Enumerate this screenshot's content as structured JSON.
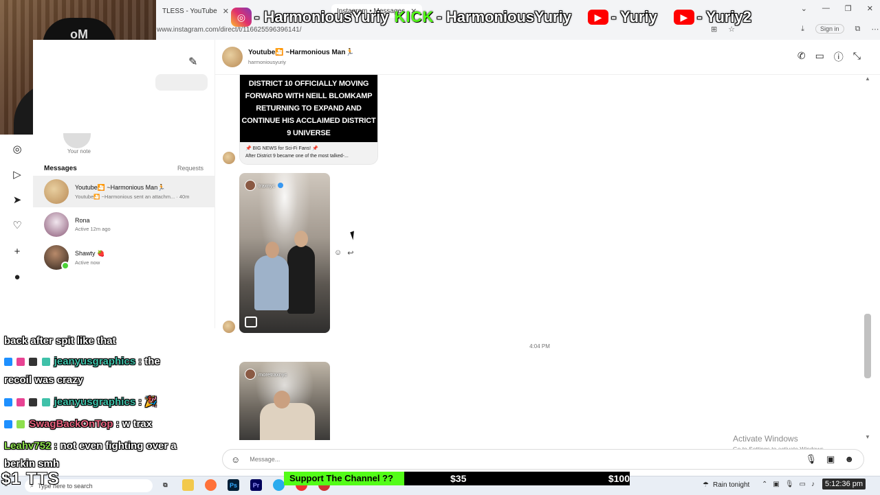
{
  "browser": {
    "tabs": [
      {
        "label": "TLESS - YouTube",
        "active": false
      },
      {
        "label": "Instagram • Messages",
        "active": true
      }
    ],
    "url": "www.instagram.com/direct/t/116625596396141/",
    "signin_label": "Sign in"
  },
  "social": {
    "instagram": "- HarmoniousYuriy",
    "kick_logo": "KICK",
    "kick": "- HarmoniousYuriy",
    "youtube1": "- Yuriy",
    "youtube2": "- Yuriy2"
  },
  "sidebar": {
    "note_label": "Your note",
    "messages_title": "Messages",
    "requests_label": "Requests",
    "conversations": [
      {
        "name": "Youtube🎦 ~Harmonious Man🏃",
        "sub": "Youtube🎦 ~Harmonious sent an attachm... · 40m",
        "avatar_color": "#c9a76c"
      },
      {
        "name": "Rona",
        "sub": "Active 12m ago",
        "avatar_color": "#8b5a78"
      },
      {
        "name": "Shawty 🍓",
        "sub": "Active now",
        "avatar_color": "#4a3a30"
      }
    ]
  },
  "chat": {
    "header_name": "Youtube🎦 ~Harmonious Man🏃",
    "header_handle": "harmoniousyuriy",
    "news_headline_lines": [
      "DISTRICT 10 OFFICIALLY MOVING",
      "FORWARD WITH NEILL BLOMKAMP",
      "RETURNING TO EXPAND AND",
      "CONTINUE HIS ACCLAIMED DISTRICT",
      "9 UNIVERSE"
    ],
    "news_caption_line1": "📌 BIG NEWS for Sci-Fi Fans! 📌",
    "news_caption_line2": "After District 9 became one of the most talked-...",
    "reel1_user": "traxnyc",
    "reel2_user": "moretraxnyc",
    "timestamp": "4:04 PM",
    "composer_placeholder": "Message..."
  },
  "activate": {
    "title": "Activate Windows",
    "sub": "Go to Settings to activate Windows."
  },
  "stream_chat": [
    {
      "user": "",
      "text": "back after spit like that",
      "color": "#ffffff"
    },
    {
      "user": "jeanyusgraphics",
      "text": ": the",
      "color": "#3fc1a9"
    },
    {
      "user": "",
      "text": "recoil was crazy",
      "color": "#ffffff"
    },
    {
      "user": "jeanyusgraphics",
      "text": ": 🎉",
      "color": "#3fc1a9"
    },
    {
      "user": "SwagBackOnTop",
      "text": ": w trax",
      "color": "#e8637f"
    },
    {
      "user": "Leahv752",
      "text": ": not even fighting over a",
      "color": "#8ee04e"
    },
    {
      "user": "",
      "text": "berkin smh",
      "color": "#ffffff"
    }
  ],
  "support": {
    "label": "Support The Channel ??",
    "current": "$35",
    "goal": "$100"
  },
  "tts_text": "$1 TTS",
  "taskbar": {
    "search_placeholder": "Type here to search",
    "weather": "Rain tonight",
    "clock": "5:12:36 pm"
  }
}
